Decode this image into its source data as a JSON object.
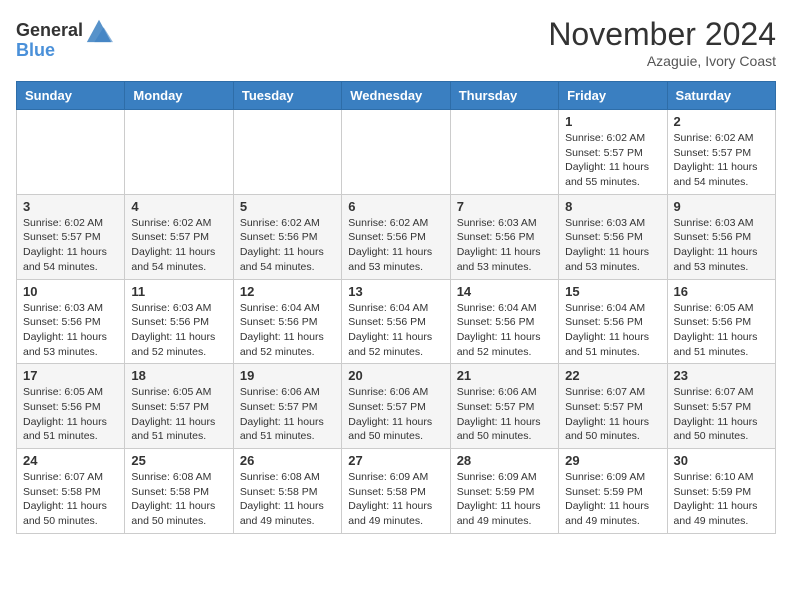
{
  "header": {
    "logo_general": "General",
    "logo_blue": "Blue",
    "month_title": "November 2024",
    "location": "Azaguie, Ivory Coast"
  },
  "days_of_week": [
    "Sunday",
    "Monday",
    "Tuesday",
    "Wednesday",
    "Thursday",
    "Friday",
    "Saturday"
  ],
  "weeks": [
    [
      {
        "day": "",
        "info": ""
      },
      {
        "day": "",
        "info": ""
      },
      {
        "day": "",
        "info": ""
      },
      {
        "day": "",
        "info": ""
      },
      {
        "day": "",
        "info": ""
      },
      {
        "day": "1",
        "info": "Sunrise: 6:02 AM\nSunset: 5:57 PM\nDaylight: 11 hours\nand 55 minutes."
      },
      {
        "day": "2",
        "info": "Sunrise: 6:02 AM\nSunset: 5:57 PM\nDaylight: 11 hours\nand 54 minutes."
      }
    ],
    [
      {
        "day": "3",
        "info": "Sunrise: 6:02 AM\nSunset: 5:57 PM\nDaylight: 11 hours\nand 54 minutes."
      },
      {
        "day": "4",
        "info": "Sunrise: 6:02 AM\nSunset: 5:57 PM\nDaylight: 11 hours\nand 54 minutes."
      },
      {
        "day": "5",
        "info": "Sunrise: 6:02 AM\nSunset: 5:56 PM\nDaylight: 11 hours\nand 54 minutes."
      },
      {
        "day": "6",
        "info": "Sunrise: 6:02 AM\nSunset: 5:56 PM\nDaylight: 11 hours\nand 53 minutes."
      },
      {
        "day": "7",
        "info": "Sunrise: 6:03 AM\nSunset: 5:56 PM\nDaylight: 11 hours\nand 53 minutes."
      },
      {
        "day": "8",
        "info": "Sunrise: 6:03 AM\nSunset: 5:56 PM\nDaylight: 11 hours\nand 53 minutes."
      },
      {
        "day": "9",
        "info": "Sunrise: 6:03 AM\nSunset: 5:56 PM\nDaylight: 11 hours\nand 53 minutes."
      }
    ],
    [
      {
        "day": "10",
        "info": "Sunrise: 6:03 AM\nSunset: 5:56 PM\nDaylight: 11 hours\nand 53 minutes."
      },
      {
        "day": "11",
        "info": "Sunrise: 6:03 AM\nSunset: 5:56 PM\nDaylight: 11 hours\nand 52 minutes."
      },
      {
        "day": "12",
        "info": "Sunrise: 6:04 AM\nSunset: 5:56 PM\nDaylight: 11 hours\nand 52 minutes."
      },
      {
        "day": "13",
        "info": "Sunrise: 6:04 AM\nSunset: 5:56 PM\nDaylight: 11 hours\nand 52 minutes."
      },
      {
        "day": "14",
        "info": "Sunrise: 6:04 AM\nSunset: 5:56 PM\nDaylight: 11 hours\nand 52 minutes."
      },
      {
        "day": "15",
        "info": "Sunrise: 6:04 AM\nSunset: 5:56 PM\nDaylight: 11 hours\nand 51 minutes."
      },
      {
        "day": "16",
        "info": "Sunrise: 6:05 AM\nSunset: 5:56 PM\nDaylight: 11 hours\nand 51 minutes."
      }
    ],
    [
      {
        "day": "17",
        "info": "Sunrise: 6:05 AM\nSunset: 5:56 PM\nDaylight: 11 hours\nand 51 minutes."
      },
      {
        "day": "18",
        "info": "Sunrise: 6:05 AM\nSunset: 5:57 PM\nDaylight: 11 hours\nand 51 minutes."
      },
      {
        "day": "19",
        "info": "Sunrise: 6:06 AM\nSunset: 5:57 PM\nDaylight: 11 hours\nand 51 minutes."
      },
      {
        "day": "20",
        "info": "Sunrise: 6:06 AM\nSunset: 5:57 PM\nDaylight: 11 hours\nand 50 minutes."
      },
      {
        "day": "21",
        "info": "Sunrise: 6:06 AM\nSunset: 5:57 PM\nDaylight: 11 hours\nand 50 minutes."
      },
      {
        "day": "22",
        "info": "Sunrise: 6:07 AM\nSunset: 5:57 PM\nDaylight: 11 hours\nand 50 minutes."
      },
      {
        "day": "23",
        "info": "Sunrise: 6:07 AM\nSunset: 5:57 PM\nDaylight: 11 hours\nand 50 minutes."
      }
    ],
    [
      {
        "day": "24",
        "info": "Sunrise: 6:07 AM\nSunset: 5:58 PM\nDaylight: 11 hours\nand 50 minutes."
      },
      {
        "day": "25",
        "info": "Sunrise: 6:08 AM\nSunset: 5:58 PM\nDaylight: 11 hours\nand 50 minutes."
      },
      {
        "day": "26",
        "info": "Sunrise: 6:08 AM\nSunset: 5:58 PM\nDaylight: 11 hours\nand 49 minutes."
      },
      {
        "day": "27",
        "info": "Sunrise: 6:09 AM\nSunset: 5:58 PM\nDaylight: 11 hours\nand 49 minutes."
      },
      {
        "day": "28",
        "info": "Sunrise: 6:09 AM\nSunset: 5:59 PM\nDaylight: 11 hours\nand 49 minutes."
      },
      {
        "day": "29",
        "info": "Sunrise: 6:09 AM\nSunset: 5:59 PM\nDaylight: 11 hours\nand 49 minutes."
      },
      {
        "day": "30",
        "info": "Sunrise: 6:10 AM\nSunset: 5:59 PM\nDaylight: 11 hours\nand 49 minutes."
      }
    ]
  ]
}
